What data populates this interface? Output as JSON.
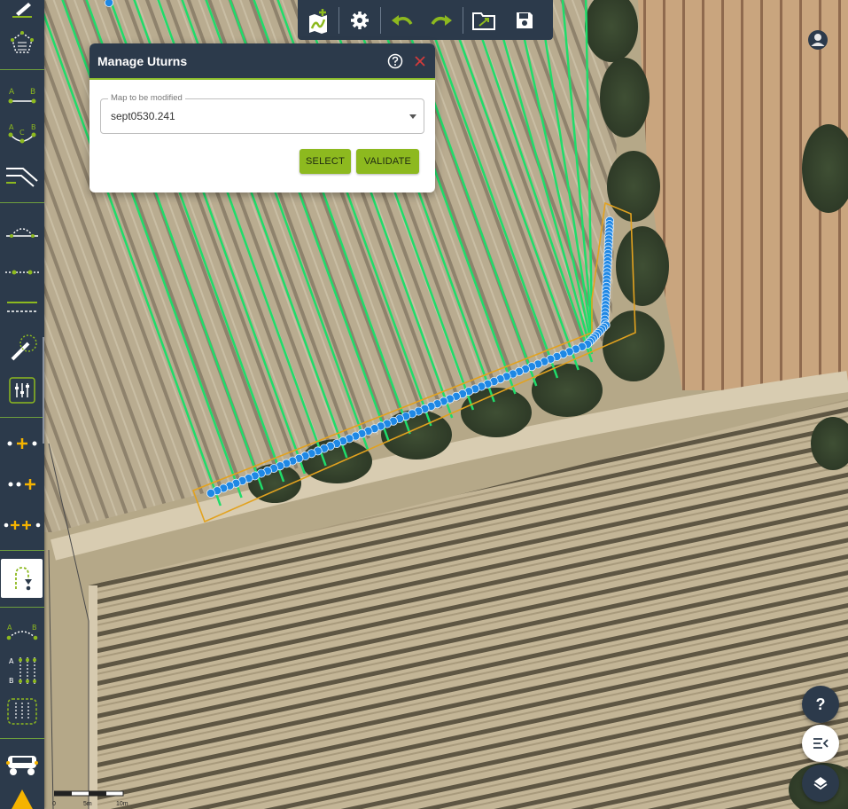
{
  "dialog": {
    "title": "Manage Uturns",
    "field_label": "Map to be modified",
    "field_value": "sept0530.241",
    "select_label": "SELECT",
    "validate_label": "VALIDATE"
  },
  "fab": {
    "help_label": "?"
  },
  "scale": {
    "labels": [
      "0",
      "5m",
      "10m"
    ]
  },
  "colors": {
    "toolbar": "#2c3a4b",
    "accent_green": "#8db91f",
    "row_green": "#1fdc6a",
    "path_blue": "#1e88e5",
    "boundary_orange": "#e2a21f",
    "close_red": "#d33b3b"
  },
  "toolbar_tools": [
    "draw-line-icon",
    "polygon-select-icon",
    "ab-line-icon",
    "abc-curve-icon",
    "offset-path-icon",
    "arc-line-icon",
    "point-line-icon",
    "parallel-lines-icon",
    "magic-wand-icon",
    "sliders-icon",
    "add-point-middle-icon",
    "add-point-end-icon",
    "add-multiple-points-icon",
    "uturn-icon",
    "ab-curve-dashed-icon",
    "ab-grid-icon",
    "grid-select-icon",
    "vehicle-icon",
    "warning-icon"
  ],
  "top_tools": [
    "add-map-icon",
    "settings-icon",
    "undo-icon",
    "redo-icon",
    "open-folder-icon",
    "save-icon"
  ]
}
